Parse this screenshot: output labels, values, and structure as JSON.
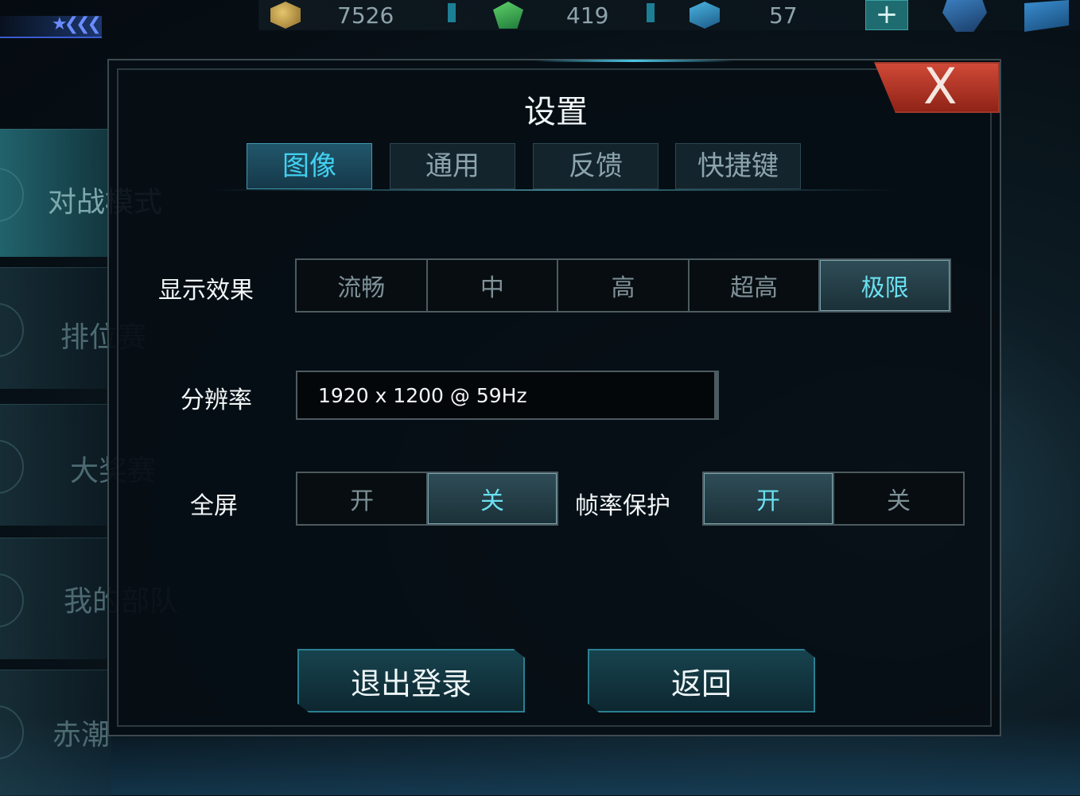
{
  "topbar": {
    "coins_icon": "coin-icon",
    "coins": "7526",
    "gems_icon": "green-gem-icon",
    "gems": "419",
    "crystals_icon": "blue-crystal-icon",
    "crystals": "57",
    "add_label": "+",
    "team_icon": "helmet-icon",
    "mail_icon": "mail-icon"
  },
  "sidebar": {
    "rank_chevrons": "★❮❮❮",
    "items": [
      {
        "label": "对战模式"
      },
      {
        "label": "排位赛"
      },
      {
        "label": "大奖赛"
      },
      {
        "label": "我的部队"
      },
      {
        "label": "赤潮"
      }
    ]
  },
  "dialog": {
    "title": "设置",
    "close_label": "X",
    "tabs": [
      {
        "label": "图像"
      },
      {
        "label": "通用"
      },
      {
        "label": "反馈"
      },
      {
        "label": "快捷键"
      }
    ],
    "selected_tab": "图像",
    "display": {
      "label": "显示效果",
      "options": [
        "流畅",
        "中",
        "高",
        "超高",
        "极限"
      ],
      "selected": "极限"
    },
    "resolution": {
      "label": "分辨率",
      "value": "1920 x 1200 @ 59Hz"
    },
    "fullscreen": {
      "label": "全屏",
      "options": [
        "开",
        "关"
      ],
      "selected": "关"
    },
    "frame_protect": {
      "label": "帧率保护",
      "options": [
        "开",
        "关"
      ],
      "selected": "开"
    },
    "logout_label": "退出登录",
    "back_label": "返回"
  },
  "colors": {
    "accent": "#43d1f2",
    "close": "#c0392b",
    "panel": "#060e14"
  }
}
